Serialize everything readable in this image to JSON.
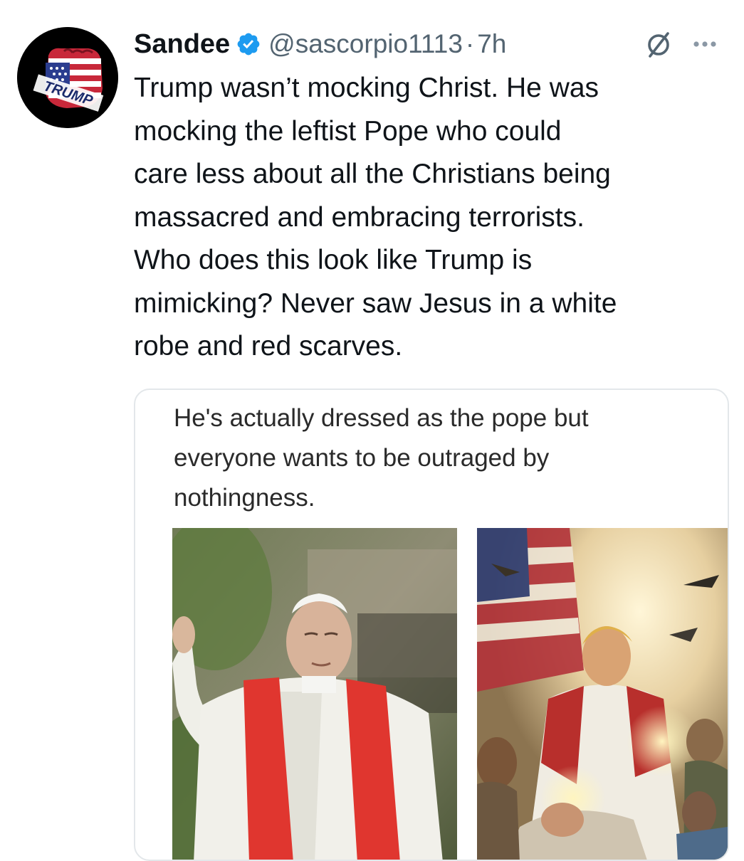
{
  "tweet": {
    "author": {
      "display_name": "Sandee",
      "handle": "@sascorpio1113",
      "separator": "·",
      "time": "7h",
      "verified": true,
      "avatar_label": "TRUMP"
    },
    "text_lines": [
      "Trump wasn’t mocking Christ. He was",
      "mocking the leftist Pope who could",
      "care less about all the Christians being",
      "massacred and embracing terrorists.",
      "Who does this look like Trump is",
      "mimicking? Never saw Jesus in a white",
      "robe and red scarves."
    ],
    "icons": {
      "verified": "verified-badge-icon",
      "grok": "grok-icon",
      "more": "more-options-icon"
    }
  },
  "quote": {
    "text_lines": [
      "He's actually dressed as the pope but",
      "everyone wants to be outraged by",
      "nothingness."
    ],
    "images": [
      {
        "subject": "pope-photo"
      },
      {
        "subject": "patriotic-painting"
      }
    ]
  },
  "colors": {
    "text": "#0f1419",
    "secondary_text": "#536471",
    "verified_blue": "#1d9bf0",
    "card_border": "#e3e7ea"
  }
}
